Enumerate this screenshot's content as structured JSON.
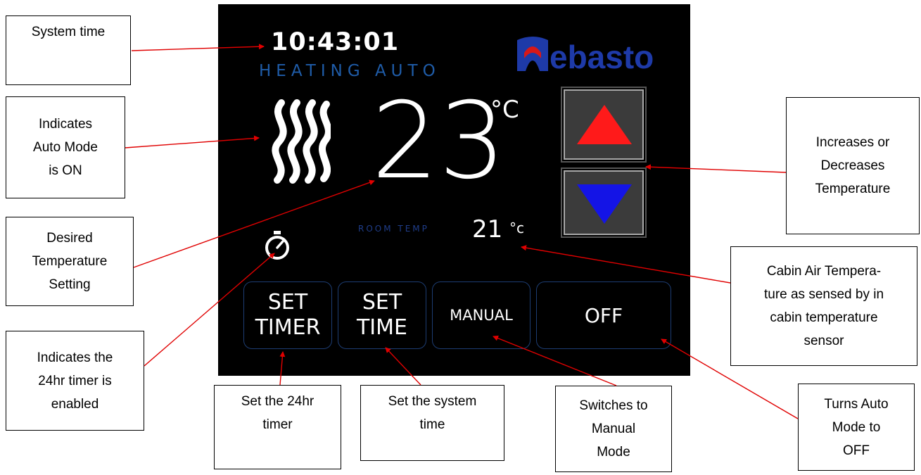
{
  "display": {
    "time": "10:43:01",
    "mode": "HEATING AUTO",
    "brand": "Webasto",
    "setpoint": "23",
    "setpoint_unit": "°C",
    "room_label": "ROOM TEMP",
    "room_temp": "21",
    "room_unit": "°c",
    "icons": {
      "heat": "heat-waves-icon",
      "timer": "stopwatch-icon",
      "up": "triangle-up-icon",
      "down": "triangle-down-icon"
    },
    "colors": {
      "up": "#ff1a1a",
      "down": "#1414e6",
      "mode": "#1f5ca8",
      "button_border": "#1d3d73"
    }
  },
  "buttons": {
    "set_timer": "SET\nTIMER",
    "set_time": "SET\nTIME",
    "manual": "MANUAL",
    "off": "OFF"
  },
  "callouts": {
    "system_time": "System time",
    "auto_mode": "Indicates\nAuto Mode\nis ON",
    "desired_temp": "Desired\nTemperature\nSetting",
    "timer_enabled": "Indicates the\n24hr timer is\nenabled",
    "set_timer": "Set the 24hr\ntimer",
    "set_time": "Set the system\ntime",
    "manual": "Switches to\nManual\nMode",
    "off": "Turns Auto\nMode to\nOFF",
    "inc_dec": "Increases or\nDecreases\nTemperature",
    "cabin_air": "Cabin Air Tempera-\nture as sensed by in\ncabin temperature\nsensor"
  }
}
